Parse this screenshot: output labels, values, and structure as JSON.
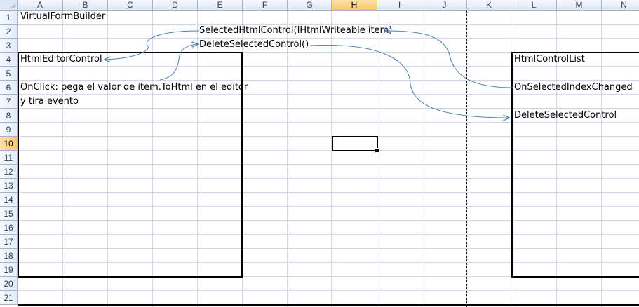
{
  "columns": [
    "A",
    "B",
    "C",
    "D",
    "E",
    "F",
    "G",
    "H",
    "I",
    "J",
    "K",
    "L",
    "M",
    "N"
  ],
  "rows": [
    "1",
    "2",
    "3",
    "4",
    "5",
    "6",
    "7",
    "8",
    "9",
    "10",
    "11",
    "12",
    "13",
    "14",
    "15",
    "16",
    "17",
    "18",
    "19",
    "20",
    "21"
  ],
  "selected_column": "H",
  "selected_row": "10",
  "cells": {
    "a1": "VirtualFormBuilder",
    "a4": "HtmlEditorControl",
    "a6": "OnClick:  pega el valor de item.ToHtml en el editor",
    "a7": "y tira evento",
    "e2": "SelectedHtmlControl(IHtmlWriteable item)",
    "e3": "DeleteSelectedControl()",
    "l4": "HtmlControlList",
    "l6": "OnSelectedIndexChanged",
    "l8": "DeleteSelectedControl"
  },
  "colors": {
    "grid": "#d0d7e5",
    "header_border": "#9eb6ce",
    "arrow": "#4f81bd",
    "selected_header": "#f9c66a"
  }
}
